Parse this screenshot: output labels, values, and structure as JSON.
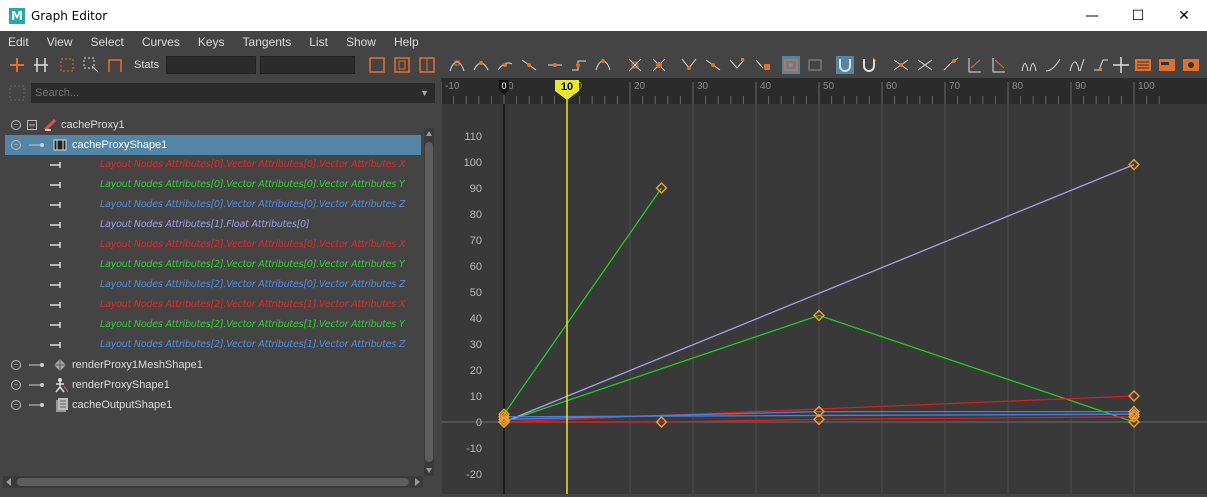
{
  "window": {
    "app_logo": "M",
    "title": "Graph Editor",
    "minimize": "—",
    "maximize": "☐",
    "close": "✕"
  },
  "menu": [
    "Edit",
    "View",
    "Select",
    "Curves",
    "Keys",
    "Tangents",
    "List",
    "Show",
    "Help"
  ],
  "toolbar": {
    "stats_label": "Stats"
  },
  "search": {
    "placeholder": "Search..."
  },
  "outliner": {
    "items": [
      {
        "label": "cacheProxy1",
        "level": 0
      },
      {
        "label": "cacheProxyShape1",
        "level": 1,
        "selected": true
      },
      {
        "label": "Layout Nodes Attributes[0].Vector Attributes[0].Vector Attributes X",
        "color": "#e0292a"
      },
      {
        "label": "Layout Nodes Attributes[0].Vector Attributes[0].Vector Attributes Y",
        "color": "#2ed12f"
      },
      {
        "label": "Layout Nodes Attributes[0].Vector Attributes[0].Vector Attributes Z",
        "color": "#4f8de3"
      },
      {
        "label": "Layout Nodes Attributes[1].Float Attributes[0]",
        "color": "#a09cf0"
      },
      {
        "label": "Layout Nodes Attributes[2].Vector Attributes[0].Vector Attributes X",
        "color": "#e0292a"
      },
      {
        "label": "Layout Nodes Attributes[2].Vector Attributes[0].Vector Attributes Y",
        "color": "#2ed12f"
      },
      {
        "label": "Layout Nodes Attributes[2].Vector Attributes[0].Vector Attributes Z",
        "color": "#4f8de3"
      },
      {
        "label": "Layout Nodes Attributes[2].Vector Attributes[1].Vector Attributes X",
        "color": "#e0292a"
      },
      {
        "label": "Layout Nodes Attributes[2].Vector Attributes[1].Vector Attributes Y",
        "color": "#2ed12f"
      },
      {
        "label": "Layout Nodes Attributes[2].Vector Attributes[1].Vector Attributes Z",
        "color": "#4f8de3"
      },
      {
        "label": "renderProxy1MeshShape1",
        "level": 0
      },
      {
        "label": "renderProxyShape1",
        "level": 0
      },
      {
        "label": "cacheOutputShape1",
        "level": 0
      }
    ]
  },
  "timeline": {
    "ticks": [
      "-10",
      "0",
      "10",
      "20",
      "30",
      "40",
      "50",
      "60",
      "70",
      "80",
      "90",
      "100"
    ],
    "current_frame": "10",
    "start_marker": "0"
  },
  "graph": {
    "y_ticks": [
      "110",
      "100",
      "90",
      "80",
      "70",
      "60",
      "50",
      "40",
      "30",
      "20",
      "10",
      "0",
      "-10",
      "-20"
    ],
    "colors": {
      "red": "#d81e1e",
      "green": "#22cc22",
      "blue": "#4a7fe0",
      "lavender": "#a8a0f0",
      "key": "#f0a030",
      "current_time": "#e8e830"
    },
    "curves": [
      {
        "color": "green",
        "keys": [
          [
            0,
            3
          ],
          [
            25,
            90
          ]
        ]
      },
      {
        "color": "green",
        "keys": [
          [
            0,
            0
          ],
          [
            50,
            41
          ],
          [
            100,
            0
          ]
        ]
      },
      {
        "color": "lavender",
        "keys": [
          [
            0,
            0
          ],
          [
            100,
            99
          ]
        ]
      },
      {
        "color": "red",
        "keys": [
          [
            0,
            0
          ],
          [
            100,
            10
          ]
        ]
      },
      {
        "color": "blue",
        "keys": [
          [
            0,
            1
          ],
          [
            50,
            4
          ],
          [
            100,
            4
          ]
        ]
      },
      {
        "color": "red",
        "keys": [
          [
            0,
            0
          ],
          [
            25,
            0
          ],
          [
            50,
            1
          ],
          [
            100,
            2
          ]
        ]
      },
      {
        "color": "blue",
        "keys": [
          [
            0,
            2
          ],
          [
            100,
            3
          ]
        ]
      }
    ]
  }
}
